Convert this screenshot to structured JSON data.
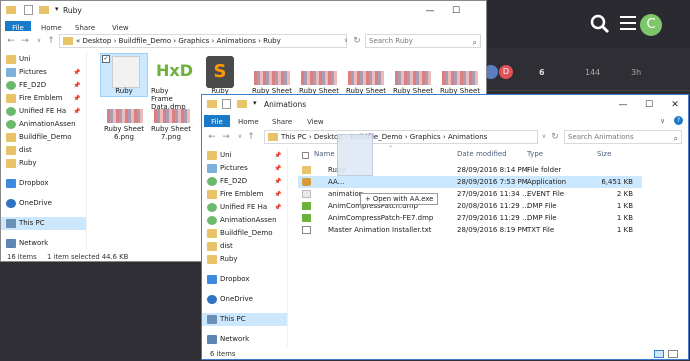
{
  "forum": {
    "avatar_letter": "C",
    "topic_avatar_letter": "D",
    "replies": "6",
    "views": "144",
    "activity": "3h"
  },
  "win1": {
    "title": "Ruby",
    "tabs": [
      "File",
      "Home",
      "Share",
      "View"
    ],
    "address": "« Desktop › Buildfile_Demo › Graphics › Animations › Ruby",
    "search_placeholder": "Search Ruby",
    "nav": [
      "Uni",
      "Pictures",
      "FE_D2D",
      "Fire Emblem",
      "Unified FE Ha",
      "AnimationAssen",
      "Buildfile_Demo",
      "dist",
      "Ruby",
      "Dropbox",
      "OneDrive",
      "This PC",
      "Network"
    ],
    "files": [
      {
        "label": "Ruby"
      },
      {
        "label": "Ruby Frame Data.dmp"
      },
      {
        "label": "Ruby"
      },
      {
        "label": "Ruby Sheet"
      },
      {
        "label": "Ruby Sheet"
      },
      {
        "label": "Ruby Sheet"
      },
      {
        "label": "Ruby Sheet"
      },
      {
        "label": "Ruby Sheet"
      },
      {
        "label": "Ruby Sheet 6.png"
      },
      {
        "label": "Ruby Sheet 7.png"
      }
    ],
    "status_items": "16 items",
    "status_selected": "1 item selected  44.6 KB"
  },
  "win2": {
    "title": "Animations",
    "tabs": [
      "File",
      "Home",
      "Share",
      "View"
    ],
    "address": "This PC › Desktop › Buildfile_Demo › Graphics › Animations",
    "search_placeholder": "Search Animations",
    "nav": [
      "Uni",
      "Pictures",
      "FE_D2D",
      "Fire Emblem",
      "Unified FE Ha",
      "AnimationAssen",
      "Buildfile_Demo",
      "dist",
      "Ruby",
      "Dropbox",
      "OneDrive",
      "This PC",
      "Network"
    ],
    "columns": [
      "Name",
      "Date modified",
      "Type",
      "Size"
    ],
    "rows": [
      {
        "name": "Ruby",
        "date": "28/09/2016 8:14 PM",
        "type": "File folder",
        "size": ""
      },
      {
        "name": "AA...",
        "date": "28/09/2016 7:53 PM",
        "type": "Application",
        "size": "6,451 KB"
      },
      {
        "name": "animationp...",
        "date": "27/09/2016 11:34 ...",
        "type": "EVENT File",
        "size": "2 KB"
      },
      {
        "name": "AnimCompressPatch.dmp",
        "date": "20/08/2016 11:29 ...",
        "type": "DMP File",
        "size": "1 KB"
      },
      {
        "name": "AnimCompressPatch-FE7.dmp",
        "date": "27/09/2016 11:29 ...",
        "type": "DMP File",
        "size": "1 KB"
      },
      {
        "name": "Master Animation Installer.txt",
        "date": "28/09/2016 8:19 PM",
        "type": "TXT File",
        "size": "1 KB"
      }
    ],
    "drag_tooltip": "+ Open with AA.exe",
    "status_items": "6 items"
  }
}
